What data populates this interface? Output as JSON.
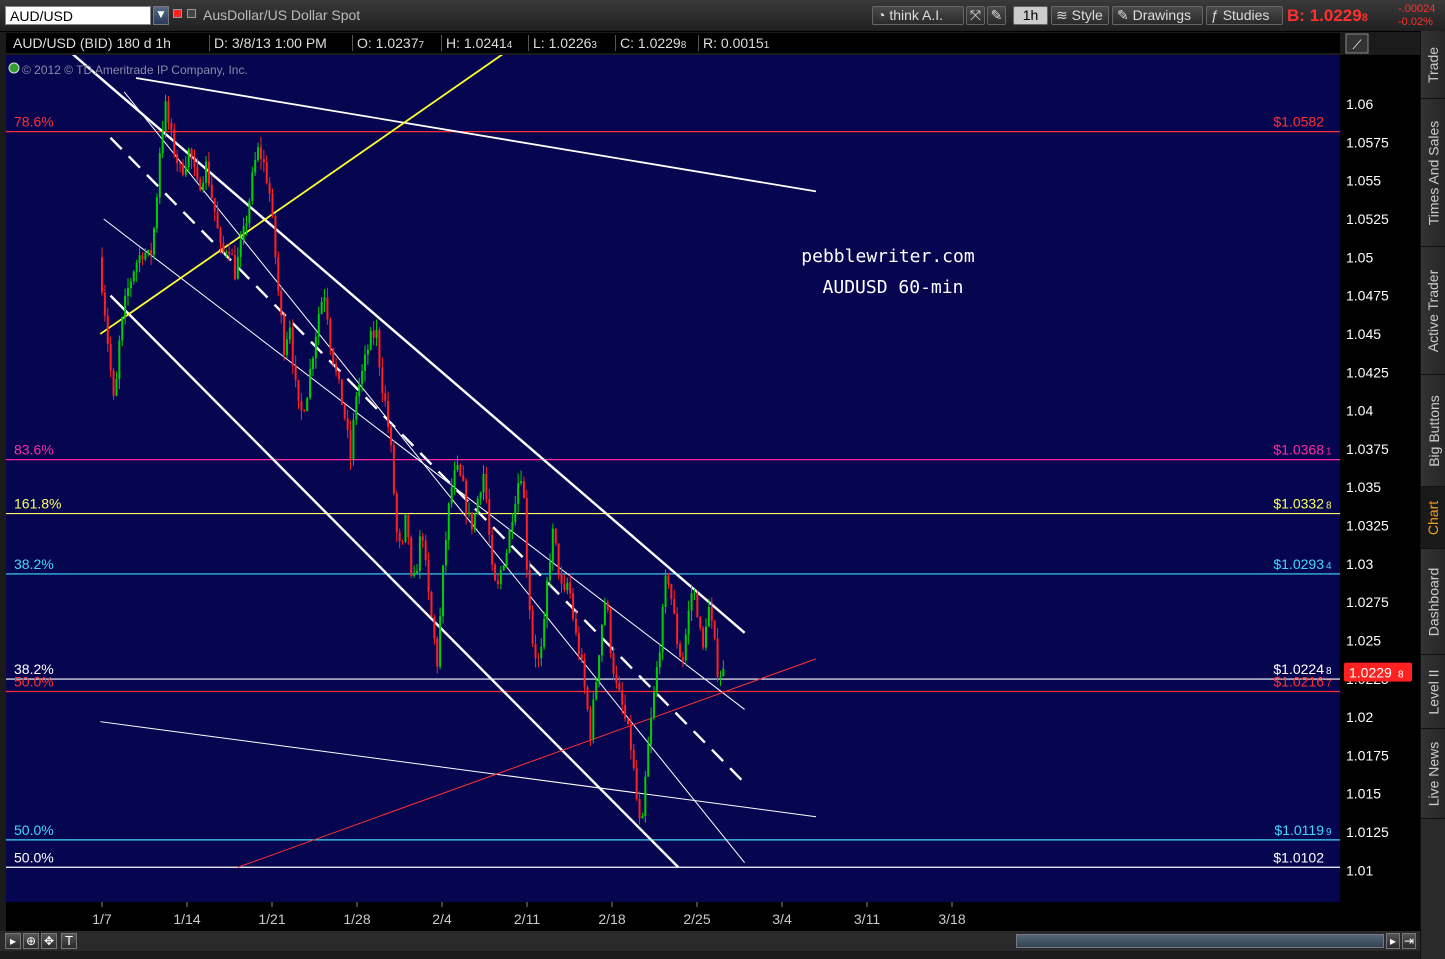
{
  "toolbar": {
    "symbol": "AUD/USD",
    "description": "AusDollar/US Dollar Spot",
    "buttons": [
      "think A.I.",
      "1h",
      "Style",
      "Drawings",
      "Studies"
    ],
    "bid_label": "B:",
    "bid_value": "1.0229",
    "bid_fraction": "8",
    "change_abs": "-.00024",
    "change_pct": "-0.02%"
  },
  "infobar": {
    "title": "AUD/USD (BID) 180 d 1h",
    "date": "D: 3/8/13 1:00 PM",
    "open": "O: 1.0237",
    "open_frac": "7",
    "high": "H: 1.0241",
    "high_frac": "4",
    "low": "L: 1.0226",
    "low_frac": "3",
    "close": "C: 1.0229",
    "close_frac": "8",
    "range": "R: 0.0015",
    "range_frac": "1"
  },
  "copyright": "© 2012 © TD Ameritrade IP Company, Inc.",
  "side_tabs": [
    "Trade",
    "Times And Sales",
    "Active Trader",
    "Big Buttons",
    "Chart",
    "Dashboard",
    "Level II",
    "Live News"
  ],
  "active_tab": "Chart",
  "colors": {
    "background": "#060650",
    "up_candle": "#00d000",
    "down_candle": "#ff2020",
    "channel": "#ffffff",
    "trend_yellow": "#ffff30",
    "trend_red": "#ff3030",
    "fib_red": "#ff3030",
    "fib_magenta": "#ff2aa0",
    "fib_yellow": "#ffff60",
    "fib_cyan": "#40d8ff",
    "fib_white": "#ffffff"
  },
  "chart_data": {
    "type": "candlestick",
    "title": "pebblewriter.com",
    "subtitle": "AUDUSD 60-min",
    "symbol": "AUD/USD",
    "interval": "1h",
    "ylim": [
      1.008,
      1.0632
    ],
    "y_ticks": [
      "1.06",
      "1.0575",
      "1.055",
      "1.0525",
      "1.05",
      "1.0475",
      "1.045",
      "1.0425",
      "1.04",
      "1.0375",
      "1.035",
      "1.0325",
      "1.03",
      "1.0275",
      "1.025",
      "1.0225",
      "1.02",
      "1.0175",
      "1.015",
      "1.0125",
      "1.01"
    ],
    "x_ticks": [
      "1/7",
      "1/14",
      "1/21",
      "1/28",
      "2/4",
      "2/11",
      "2/18",
      "2/25",
      "3/4",
      "3/11",
      "3/18"
    ],
    "last_price": "1.0229",
    "last_price_frac": "8",
    "price_path": [
      [
        0,
        1.05
      ],
      [
        0.3,
        1.047
      ],
      [
        0.6,
        1.0435
      ],
      [
        0.9,
        1.04
      ],
      [
        1.2,
        1.0445
      ],
      [
        1.6,
        1.0475
      ],
      [
        2.1,
        1.0495
      ],
      [
        2.6,
        1.0505
      ],
      [
        3.0,
        1.0498
      ],
      [
        3.3,
        1.0525
      ],
      [
        3.6,
        1.0575
      ],
      [
        3.9,
        1.0598
      ],
      [
        4.3,
        1.0575
      ],
      [
        4.8,
        1.0555
      ],
      [
        5.3,
        1.057
      ],
      [
        5.8,
        1.0545
      ],
      [
        6.3,
        1.056
      ],
      [
        6.8,
        1.053
      ],
      [
        7.2,
        1.05
      ],
      [
        7.6,
        1.051
      ],
      [
        8.0,
        1.049
      ],
      [
        8.3,
        1.0505
      ],
      [
        8.6,
        1.052
      ],
      [
        9.0,
        1.055
      ],
      [
        9.3,
        1.057
      ],
      [
        9.6,
        1.0565
      ],
      [
        10.0,
        1.0545
      ],
      [
        10.3,
        1.051
      ],
      [
        10.6,
        1.047
      ],
      [
        10.9,
        1.044
      ],
      [
        11.2,
        1.046
      ],
      [
        11.5,
        1.042
      ],
      [
        11.8,
        1.0395
      ],
      [
        12.2,
        1.041
      ],
      [
        12.6,
        1.044
      ],
      [
        13.0,
        1.047
      ],
      [
        13.3,
        1.0478
      ],
      [
        13.6,
        1.0445
      ],
      [
        14.0,
        1.042
      ],
      [
        14.4,
        1.04
      ],
      [
        14.8,
        1.0368
      ],
      [
        15.1,
        1.041
      ],
      [
        15.5,
        1.0425
      ],
      [
        15.9,
        1.0445
      ],
      [
        16.3,
        1.0452
      ],
      [
        16.6,
        1.042
      ],
      [
        16.9,
        1.04
      ],
      [
        17.2,
        1.037
      ],
      [
        17.5,
        1.032
      ],
      [
        17.8,
        1.0305
      ],
      [
        18.1,
        1.0335
      ],
      [
        18.4,
        1.028
      ],
      [
        18.7,
        1.03
      ],
      [
        19.0,
        1.0325
      ],
      [
        19.3,
        1.0285
      ],
      [
        19.6,
        1.026
      ],
      [
        19.9,
        1.0235
      ],
      [
        20.2,
        1.029
      ],
      [
        20.5,
        1.033
      ],
      [
        20.8,
        1.0355
      ],
      [
        21.1,
        1.036
      ],
      [
        21.4,
        1.035
      ],
      [
        21.7,
        1.033
      ],
      [
        22.0,
        1.0325
      ],
      [
        22.3,
        1.0345
      ],
      [
        22.6,
        1.036
      ],
      [
        22.8,
        1.034
      ],
      [
        23.1,
        1.0295
      ],
      [
        23.4,
        1.028
      ],
      [
        23.7,
        1.03
      ],
      [
        24.0,
        1.031
      ],
      [
        24.4,
        1.034
      ],
      [
        24.8,
        1.0362
      ],
      [
        25.0,
        1.034
      ],
      [
        25.2,
        1.029
      ],
      [
        25.5,
        1.025
      ],
      [
        25.8,
        1.0235
      ],
      [
        26.1,
        1.0245
      ],
      [
        26.4,
        1.0295
      ],
      [
        26.7,
        1.032
      ],
      [
        27.0,
        1.03
      ],
      [
        27.3,
        1.0275
      ],
      [
        27.6,
        1.029
      ],
      [
        28.0,
        1.0255
      ],
      [
        28.3,
        1.024
      ],
      [
        28.6,
        1.0215
      ],
      [
        28.9,
        1.019
      ],
      [
        29.2,
        1.022
      ],
      [
        29.5,
        1.0255
      ],
      [
        29.8,
        1.028
      ],
      [
        30.1,
        1.0245
      ],
      [
        30.4,
        1.022
      ],
      [
        30.7,
        1.021
      ],
      [
        31.0,
        1.0195
      ],
      [
        31.3,
        1.018
      ],
      [
        31.6,
        1.0148
      ],
      [
        31.9,
        1.012
      ],
      [
        32.2,
        1.017
      ],
      [
        32.5,
        1.02
      ],
      [
        32.8,
        1.023
      ],
      [
        33.1,
        1.026
      ],
      [
        33.4,
        1.0297
      ],
      [
        33.7,
        1.0275
      ],
      [
        34.0,
        1.025
      ],
      [
        34.3,
        1.0235
      ],
      [
        34.6,
        1.0262
      ],
      [
        34.9,
        1.0285
      ],
      [
        35.2,
        1.027
      ],
      [
        35.5,
        1.024
      ],
      [
        35.8,
        1.0275
      ],
      [
        36.1,
        1.0255
      ],
      [
        36.4,
        1.023
      ],
      [
        36.6,
        1.0229
      ]
    ],
    "fib_levels": [
      {
        "label": "78.6%",
        "price": "$1.0582",
        "price_frac": "",
        "value": 1.0582,
        "color_key": "fib_red"
      },
      {
        "label": "83.6%",
        "price": "$1.0368",
        "price_frac": "1",
        "value": 1.0368,
        "color_key": "fib_magenta"
      },
      {
        "label": "161.8%",
        "price": "$1.0332",
        "price_frac": "8",
        "value": 1.03328,
        "color_key": "fib_yellow"
      },
      {
        "label": "38.2%",
        "price": "$1.0293",
        "price_frac": "4",
        "value": 1.02934,
        "color_key": "fib_cyan"
      },
      {
        "label": "38.2%",
        "price": "$1.0224",
        "price_frac": "8",
        "value": 1.02248,
        "color_key": "fib_white"
      },
      {
        "label": "50.0%",
        "price": "$1.0216",
        "price_frac": "7",
        "value": 1.02167,
        "color_key": "fib_red"
      },
      {
        "label": "50.0%",
        "price": "$1.0119",
        "price_frac": "9",
        "value": 1.01199,
        "color_key": "fib_cyan"
      },
      {
        "label": "50.0%",
        "price": "$1.0102",
        "price_frac": "",
        "value": 1.0102,
        "color_key": "fib_white"
      }
    ],
    "trendlines": [
      {
        "name": "channel-upper",
        "from": [
          -2.5,
          1.064
        ],
        "to": [
          37.8,
          1.0255
        ],
        "style": "solid-thick",
        "color_key": "channel"
      },
      {
        "name": "channel-upper-inner",
        "from": [
          0.1,
          1.0525
        ],
        "to": [
          37.8,
          1.0205
        ],
        "style": "solid-thin",
        "color_key": "channel"
      },
      {
        "name": "channel-mid",
        "from": [
          0.5,
          1.0578
        ],
        "to": [
          37.8,
          1.0157
        ],
        "style": "dashed",
        "color_key": "channel"
      },
      {
        "name": "channel-lower-inner",
        "from": [
          1.3,
          1.0608
        ],
        "to": [
          37.8,
          1.0105
        ],
        "style": "solid-thin",
        "color_key": "channel"
      },
      {
        "name": "channel-lower",
        "from": [
          0.5,
          1.0475
        ],
        "to": [
          33.9,
          1.0102
        ],
        "style": "solid-thick",
        "color_key": "channel"
      },
      {
        "name": "long-top",
        "from": [
          2.0,
          1.0617
        ],
        "to": [
          42.0,
          1.0543
        ],
        "style": "solid-medium",
        "color_key": "channel"
      },
      {
        "name": "long-bottom",
        "from": [
          -0.1,
          1.0197
        ],
        "to": [
          42.0,
          1.0135
        ],
        "style": "solid-thin",
        "color_key": "channel"
      },
      {
        "name": "yellow-support",
        "from": [
          -0.1,
          1.045
        ],
        "to": [
          24.8,
          1.0642
        ],
        "style": "solid-medium",
        "color_key": "trend_yellow"
      },
      {
        "name": "red-support",
        "from": [
          8.0,
          1.0102
        ],
        "to": [
          42.0,
          1.0238
        ],
        "style": "solid-thin",
        "color_key": "trend_red"
      }
    ]
  }
}
